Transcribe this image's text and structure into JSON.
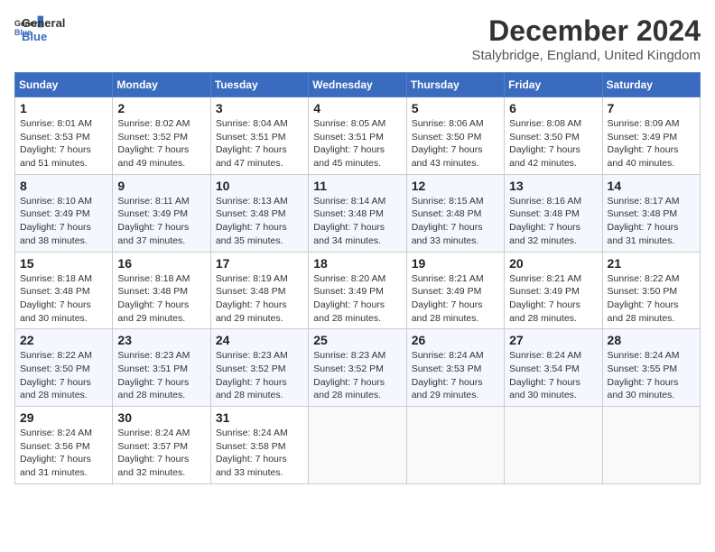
{
  "header": {
    "logo_line1": "General",
    "logo_line2": "Blue",
    "month_title": "December 2024",
    "location": "Stalybridge, England, United Kingdom"
  },
  "days_of_week": [
    "Sunday",
    "Monday",
    "Tuesday",
    "Wednesday",
    "Thursday",
    "Friday",
    "Saturday"
  ],
  "weeks": [
    [
      {
        "day": "1",
        "sunrise": "Sunrise: 8:01 AM",
        "sunset": "Sunset: 3:53 PM",
        "daylight": "Daylight: 7 hours and 51 minutes."
      },
      {
        "day": "2",
        "sunrise": "Sunrise: 8:02 AM",
        "sunset": "Sunset: 3:52 PM",
        "daylight": "Daylight: 7 hours and 49 minutes."
      },
      {
        "day": "3",
        "sunrise": "Sunrise: 8:04 AM",
        "sunset": "Sunset: 3:51 PM",
        "daylight": "Daylight: 7 hours and 47 minutes."
      },
      {
        "day": "4",
        "sunrise": "Sunrise: 8:05 AM",
        "sunset": "Sunset: 3:51 PM",
        "daylight": "Daylight: 7 hours and 45 minutes."
      },
      {
        "day": "5",
        "sunrise": "Sunrise: 8:06 AM",
        "sunset": "Sunset: 3:50 PM",
        "daylight": "Daylight: 7 hours and 43 minutes."
      },
      {
        "day": "6",
        "sunrise": "Sunrise: 8:08 AM",
        "sunset": "Sunset: 3:50 PM",
        "daylight": "Daylight: 7 hours and 42 minutes."
      },
      {
        "day": "7",
        "sunrise": "Sunrise: 8:09 AM",
        "sunset": "Sunset: 3:49 PM",
        "daylight": "Daylight: 7 hours and 40 minutes."
      }
    ],
    [
      {
        "day": "8",
        "sunrise": "Sunrise: 8:10 AM",
        "sunset": "Sunset: 3:49 PM",
        "daylight": "Daylight: 7 hours and 38 minutes."
      },
      {
        "day": "9",
        "sunrise": "Sunrise: 8:11 AM",
        "sunset": "Sunset: 3:49 PM",
        "daylight": "Daylight: 7 hours and 37 minutes."
      },
      {
        "day": "10",
        "sunrise": "Sunrise: 8:13 AM",
        "sunset": "Sunset: 3:48 PM",
        "daylight": "Daylight: 7 hours and 35 minutes."
      },
      {
        "day": "11",
        "sunrise": "Sunrise: 8:14 AM",
        "sunset": "Sunset: 3:48 PM",
        "daylight": "Daylight: 7 hours and 34 minutes."
      },
      {
        "day": "12",
        "sunrise": "Sunrise: 8:15 AM",
        "sunset": "Sunset: 3:48 PM",
        "daylight": "Daylight: 7 hours and 33 minutes."
      },
      {
        "day": "13",
        "sunrise": "Sunrise: 8:16 AM",
        "sunset": "Sunset: 3:48 PM",
        "daylight": "Daylight: 7 hours and 32 minutes."
      },
      {
        "day": "14",
        "sunrise": "Sunrise: 8:17 AM",
        "sunset": "Sunset: 3:48 PM",
        "daylight": "Daylight: 7 hours and 31 minutes."
      }
    ],
    [
      {
        "day": "15",
        "sunrise": "Sunrise: 8:18 AM",
        "sunset": "Sunset: 3:48 PM",
        "daylight": "Daylight: 7 hours and 30 minutes."
      },
      {
        "day": "16",
        "sunrise": "Sunrise: 8:18 AM",
        "sunset": "Sunset: 3:48 PM",
        "daylight": "Daylight: 7 hours and 29 minutes."
      },
      {
        "day": "17",
        "sunrise": "Sunrise: 8:19 AM",
        "sunset": "Sunset: 3:48 PM",
        "daylight": "Daylight: 7 hours and 29 minutes."
      },
      {
        "day": "18",
        "sunrise": "Sunrise: 8:20 AM",
        "sunset": "Sunset: 3:49 PM",
        "daylight": "Daylight: 7 hours and 28 minutes."
      },
      {
        "day": "19",
        "sunrise": "Sunrise: 8:21 AM",
        "sunset": "Sunset: 3:49 PM",
        "daylight": "Daylight: 7 hours and 28 minutes."
      },
      {
        "day": "20",
        "sunrise": "Sunrise: 8:21 AM",
        "sunset": "Sunset: 3:49 PM",
        "daylight": "Daylight: 7 hours and 28 minutes."
      },
      {
        "day": "21",
        "sunrise": "Sunrise: 8:22 AM",
        "sunset": "Sunset: 3:50 PM",
        "daylight": "Daylight: 7 hours and 28 minutes."
      }
    ],
    [
      {
        "day": "22",
        "sunrise": "Sunrise: 8:22 AM",
        "sunset": "Sunset: 3:50 PM",
        "daylight": "Daylight: 7 hours and 28 minutes."
      },
      {
        "day": "23",
        "sunrise": "Sunrise: 8:23 AM",
        "sunset": "Sunset: 3:51 PM",
        "daylight": "Daylight: 7 hours and 28 minutes."
      },
      {
        "day": "24",
        "sunrise": "Sunrise: 8:23 AM",
        "sunset": "Sunset: 3:52 PM",
        "daylight": "Daylight: 7 hours and 28 minutes."
      },
      {
        "day": "25",
        "sunrise": "Sunrise: 8:23 AM",
        "sunset": "Sunset: 3:52 PM",
        "daylight": "Daylight: 7 hours and 28 minutes."
      },
      {
        "day": "26",
        "sunrise": "Sunrise: 8:24 AM",
        "sunset": "Sunset: 3:53 PM",
        "daylight": "Daylight: 7 hours and 29 minutes."
      },
      {
        "day": "27",
        "sunrise": "Sunrise: 8:24 AM",
        "sunset": "Sunset: 3:54 PM",
        "daylight": "Daylight: 7 hours and 30 minutes."
      },
      {
        "day": "28",
        "sunrise": "Sunrise: 8:24 AM",
        "sunset": "Sunset: 3:55 PM",
        "daylight": "Daylight: 7 hours and 30 minutes."
      }
    ],
    [
      {
        "day": "29",
        "sunrise": "Sunrise: 8:24 AM",
        "sunset": "Sunset: 3:56 PM",
        "daylight": "Daylight: 7 hours and 31 minutes."
      },
      {
        "day": "30",
        "sunrise": "Sunrise: 8:24 AM",
        "sunset": "Sunset: 3:57 PM",
        "daylight": "Daylight: 7 hours and 32 minutes."
      },
      {
        "day": "31",
        "sunrise": "Sunrise: 8:24 AM",
        "sunset": "Sunset: 3:58 PM",
        "daylight": "Daylight: 7 hours and 33 minutes."
      },
      null,
      null,
      null,
      null
    ]
  ]
}
